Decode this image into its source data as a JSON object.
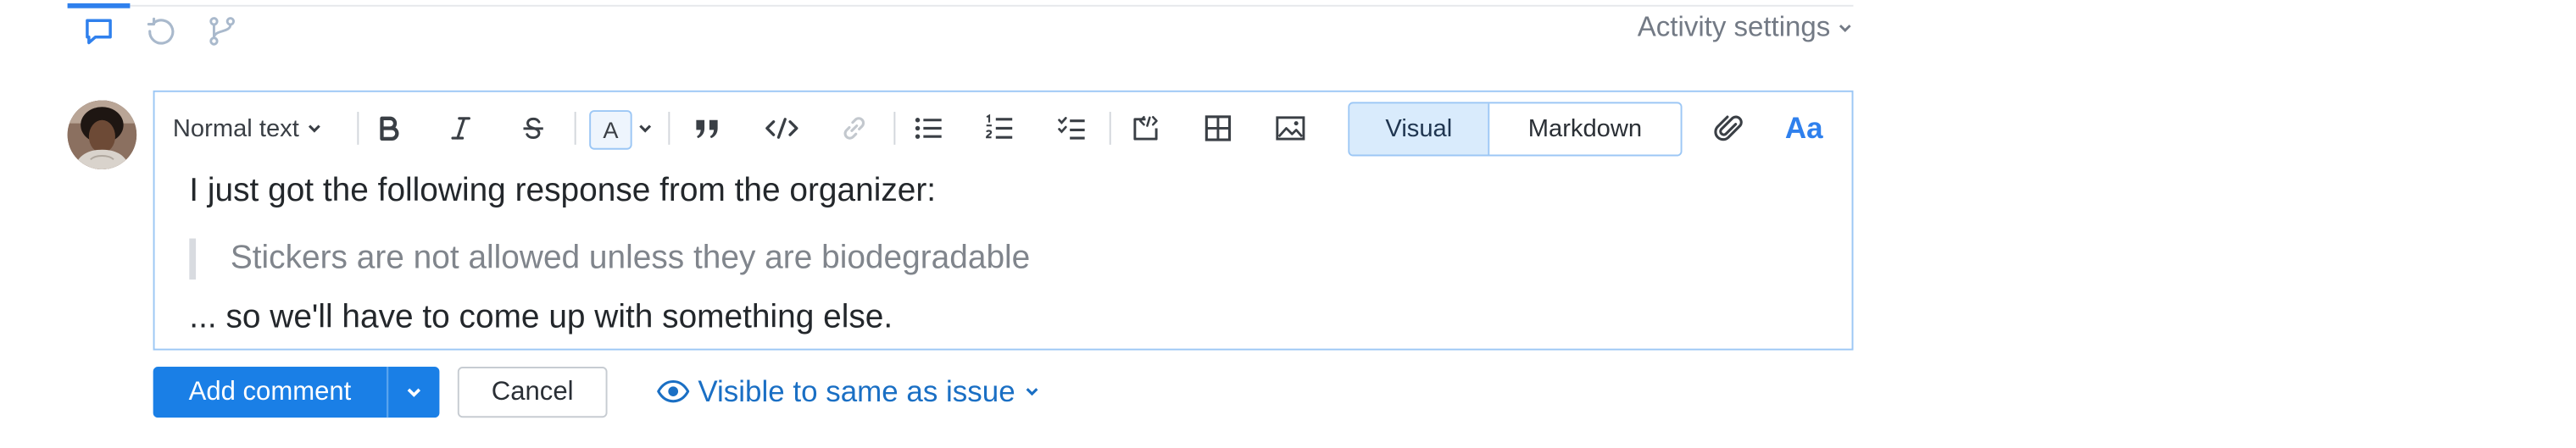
{
  "header": {
    "activity_settings_label": "Activity settings",
    "tabs": [
      {
        "icon": "comment-icon",
        "active": true
      },
      {
        "icon": "history-icon",
        "active": false
      },
      {
        "icon": "branch-icon",
        "active": false
      }
    ]
  },
  "avatar": {
    "icon": "user-avatar"
  },
  "toolbar": {
    "block_style_label": "Normal text",
    "text_color_letter": "A",
    "mode_visual_label": "Visual",
    "mode_markdown_label": "Markdown",
    "active_mode": "Visual",
    "text_style_button_label": "Aa",
    "buttons": [
      "bold-icon",
      "italic-icon",
      "strikethrough-icon",
      "text-color-icon",
      "quote-icon",
      "code-icon",
      "link-icon",
      "bulleted-list-icon",
      "numbered-list-icon",
      "checklist-icon",
      "code-block-icon",
      "table-icon",
      "image-icon",
      "attachment-icon"
    ]
  },
  "editor": {
    "paragraph_1": "I just got the following response from the organizer:",
    "blockquote": "Stickers are not allowed unless they are biodegradable",
    "paragraph_2": "... so we'll have to come up with something else."
  },
  "actions": {
    "add_comment_label": "Add comment",
    "cancel_label": "Cancel",
    "visibility_label": "Visible to same as issue"
  },
  "colors": {
    "accent": "#1a7fe6",
    "link": "#1a6fc4",
    "editor_border": "#9cc7f5",
    "active_mode_bg": "#d9ebfc"
  }
}
